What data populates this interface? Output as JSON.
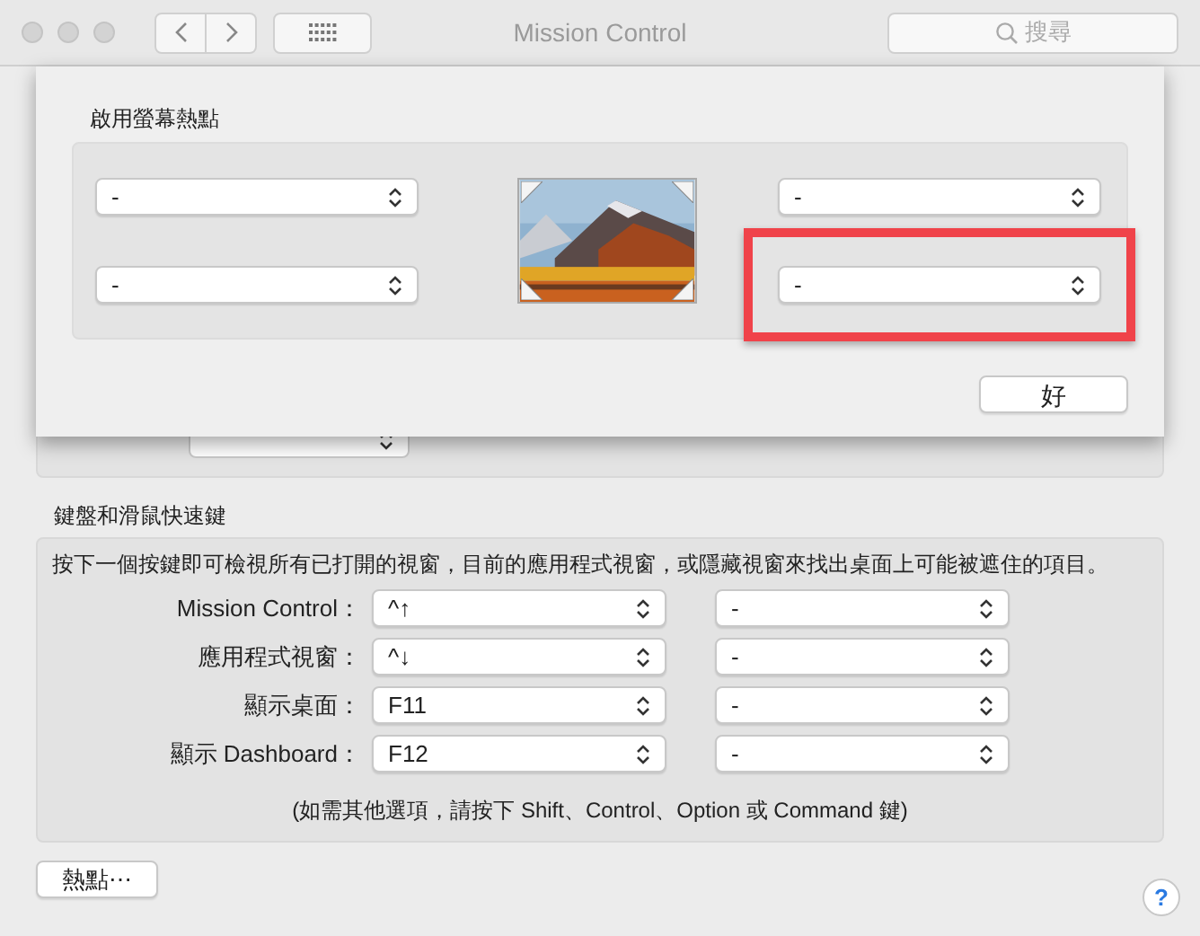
{
  "window": {
    "title": "Mission Control",
    "search": {
      "placeholder": "搜尋"
    }
  },
  "sheet": {
    "title": "啟用螢幕熱點",
    "corners": [
      {
        "value": "-",
        "highlighted": false
      },
      {
        "value": "-",
        "highlighted": false
      },
      {
        "value": "-",
        "highlighted": false
      },
      {
        "value": "-",
        "highlighted": true
      }
    ],
    "ok_button": "好"
  },
  "shortcuts": {
    "title": "鍵盤和滑鼠快速鍵",
    "description": "按下一個按鍵即可檢視所有已打開的視窗，目前的應用程式視窗，或隱藏視窗來找出桌面上可能被遮住的項目。",
    "rows": [
      {
        "label": "Mission Control：",
        "primary": "^↑",
        "secondary": "-"
      },
      {
        "label": "應用程式視窗：",
        "primary": "^↓",
        "secondary": "-"
      },
      {
        "label": "顯示桌面：",
        "primary": "F11",
        "secondary": "-"
      },
      {
        "label": "顯示 Dashboard：",
        "primary": "F12",
        "secondary": "-"
      }
    ],
    "note": "(如需其他選項，請按下 Shift、Control、Option 或 Command 鍵)"
  },
  "hot_corners_button": "熱點⋯",
  "help_button": "?"
}
